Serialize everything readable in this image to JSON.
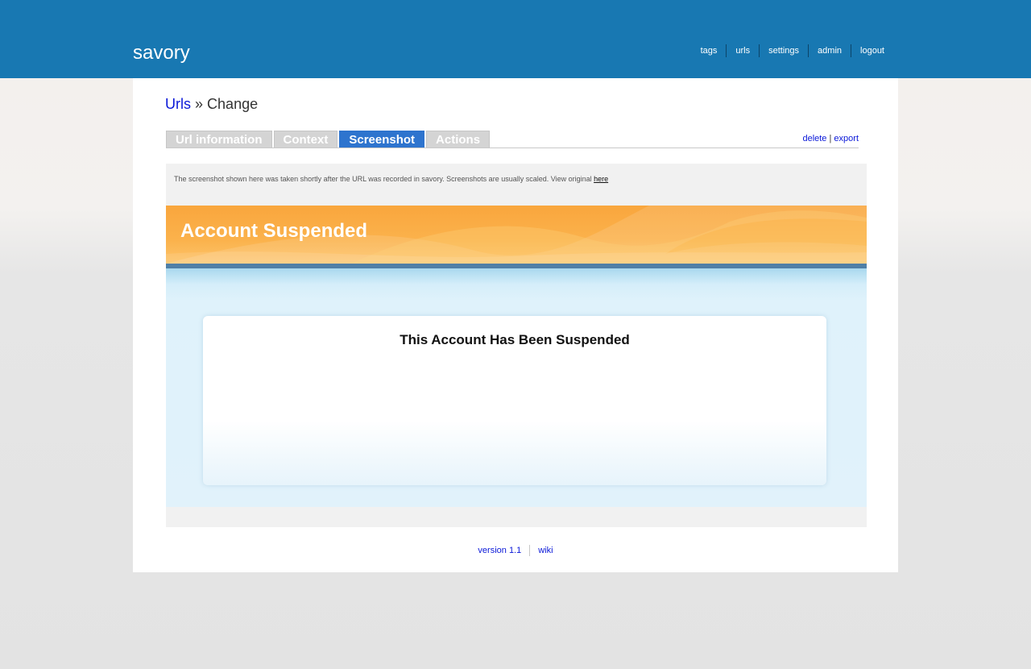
{
  "app": {
    "name": "savory"
  },
  "topnav": {
    "items": [
      "tags",
      "urls",
      "settings",
      "admin",
      "logout"
    ]
  },
  "breadcrumb": {
    "link": "Urls",
    "separator": "»",
    "current": "Change"
  },
  "tabs": [
    {
      "label": "Url information",
      "active": false
    },
    {
      "label": "Context",
      "active": false
    },
    {
      "label": "Screenshot",
      "active": true
    },
    {
      "label": "Actions",
      "active": false
    }
  ],
  "record_actions": {
    "delete": "delete",
    "separator": "|",
    "export": "export"
  },
  "screenshot": {
    "note": "The screenshot shown here was taken shortly after the URL was recorded in savory. Screenshots are usually scaled. View original",
    "note_link": "here",
    "header_title": "Account Suspended",
    "card_title": "This Account Has Been Suspended"
  },
  "footer": {
    "version": "version 1.1",
    "wiki": "wiki"
  },
  "colors": {
    "topbar": "#1878b2",
    "active_tab": "#2e74ce",
    "link": "#0a18d8",
    "banner": "#f9a63d"
  }
}
